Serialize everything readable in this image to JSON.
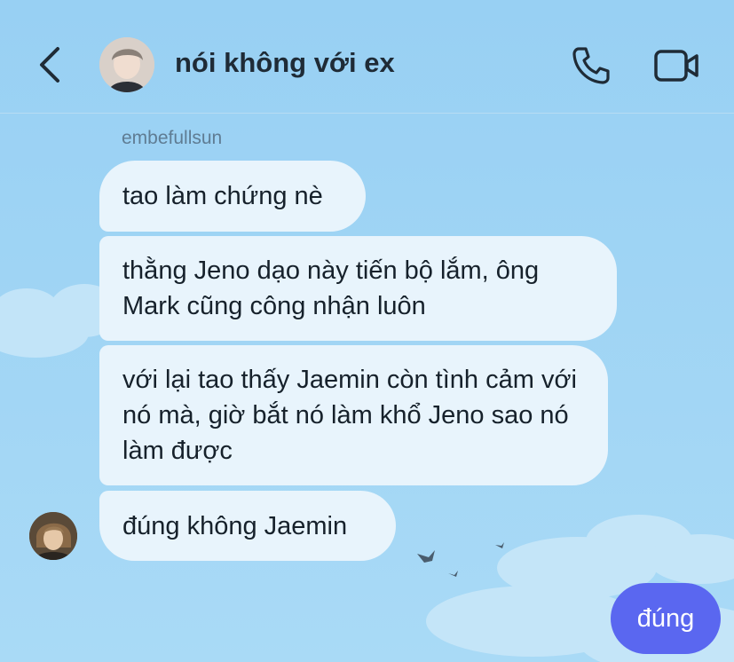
{
  "header": {
    "title": "nói không với ex",
    "back_icon": "chevron-left-icon",
    "call_icon": "phone-icon",
    "video_icon": "video-camera-icon"
  },
  "messages": {
    "sender_name": "embefullsun",
    "incoming": [
      "tao làm chứng nè",
      "thằng Jeno dạo này tiến bộ lắm, ông Mark cũng công nhận luôn",
      "với lại tao thấy Jaemin còn tình cảm với nó mà, giờ bắt nó làm khổ Jeno sao nó làm được",
      "đúng không Jaemin"
    ],
    "outgoing": [
      "đúng"
    ]
  },
  "colors": {
    "background": "#9dd3f4",
    "incoming_bubble": "#e8f4fc",
    "outgoing_bubble": "#5a67f0",
    "text": "#16212b",
    "sender_name": "#5f7c93"
  }
}
